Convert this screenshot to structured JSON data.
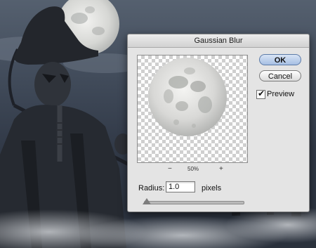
{
  "dialog": {
    "title": "Gaussian Blur",
    "ok_label": "OK",
    "cancel_label": "Cancel",
    "preview_label": "Preview",
    "preview_checked": true,
    "zoom_out_label": "−",
    "zoom_level": "50%",
    "zoom_in_label": "+",
    "radius_label": "Radius:",
    "radius_value": "1.0",
    "radius_unit": "pixels"
  },
  "icons": {
    "check": "✔"
  },
  "colors": {
    "ok_button": "#a6bfe3",
    "dialog_bg": "#e4e4e4"
  }
}
